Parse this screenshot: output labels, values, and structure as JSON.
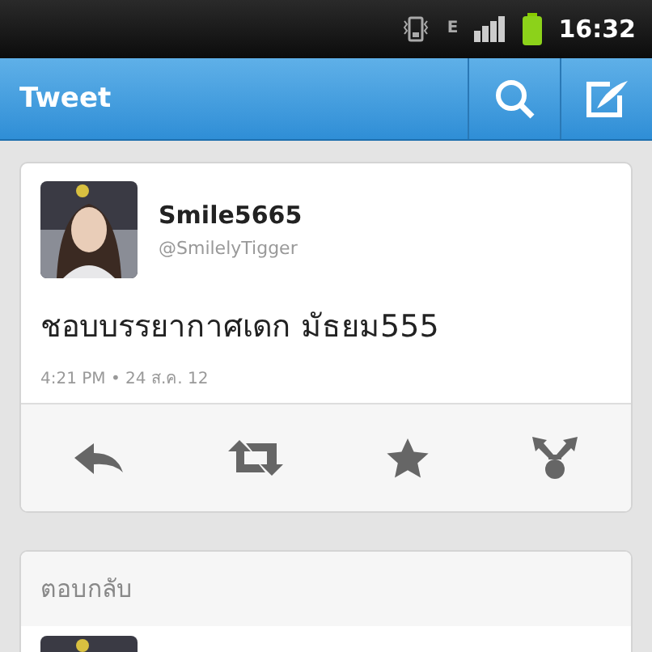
{
  "status_bar": {
    "time": "16:32",
    "network": "E"
  },
  "header": {
    "title": "Tweet"
  },
  "tweet": {
    "name": "Smile5665",
    "handle": "@SmilelyTigger",
    "text": "ชอบบรรยากาศเดก มัธยม555",
    "timestamp": "4:21 PM • 24 ส.ค. 12"
  },
  "replies": {
    "title": "ตอบกลับ"
  }
}
